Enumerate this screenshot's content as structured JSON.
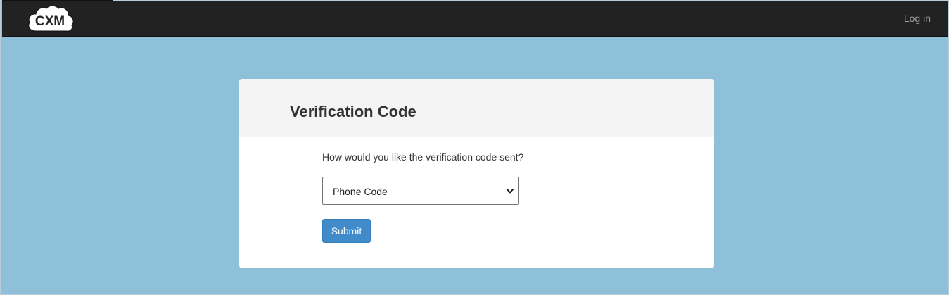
{
  "navbar": {
    "logo_text": "CXM",
    "login_label": "Log in",
    "background_color": "#222222",
    "link_color": "#9d9d9d"
  },
  "page": {
    "background_color": "#8ec0d9"
  },
  "card": {
    "title": "Verification Code",
    "prompt": "How would you like the verification code sent?",
    "method_select": {
      "selected": "Phone Code",
      "icon": "chevron-down-icon"
    },
    "submit_label": "Submit",
    "accent_color": "#428bca"
  }
}
